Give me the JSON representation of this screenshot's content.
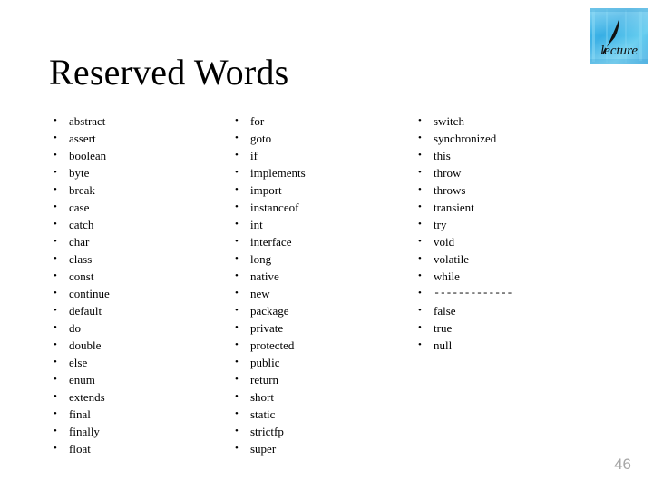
{
  "slide": {
    "title": "Reserved Words",
    "page_number": "46",
    "background_color": "#ffffff",
    "text_color": "#000000",
    "page_number_color": "#a6a6a6"
  },
  "logo": {
    "name": "lecture-watercolor-logo",
    "caption": "lecture",
    "primary_color": "#3CB4E8",
    "secondary_color": "#7FD6F2",
    "quill_color": "#111111"
  },
  "bullet": {
    "glyph": "•"
  },
  "columns": [
    {
      "name": "column-1",
      "items": [
        "abstract",
        "assert",
        "boolean",
        "byte",
        "break",
        "case",
        "catch",
        "char",
        "class",
        "const",
        "continue",
        "default",
        "do",
        "double",
        "else",
        "enum",
        "extends",
        "final",
        "finally",
        "float"
      ]
    },
    {
      "name": "column-2",
      "items": [
        "for",
        "goto",
        "if",
        "implements",
        "import",
        "instanceof",
        "int",
        "interface",
        "long",
        "native",
        "new",
        "package",
        "private",
        "protected",
        "public",
        "return",
        "short",
        "static",
        "strictfp",
        "super"
      ]
    },
    {
      "name": "column-3",
      "items": [
        "switch",
        "synchronized",
        "this",
        "throw",
        "throws",
        "transient",
        "try",
        "void",
        "volatile",
        "while",
        "-------------",
        "false",
        "true",
        "null"
      ]
    }
  ]
}
